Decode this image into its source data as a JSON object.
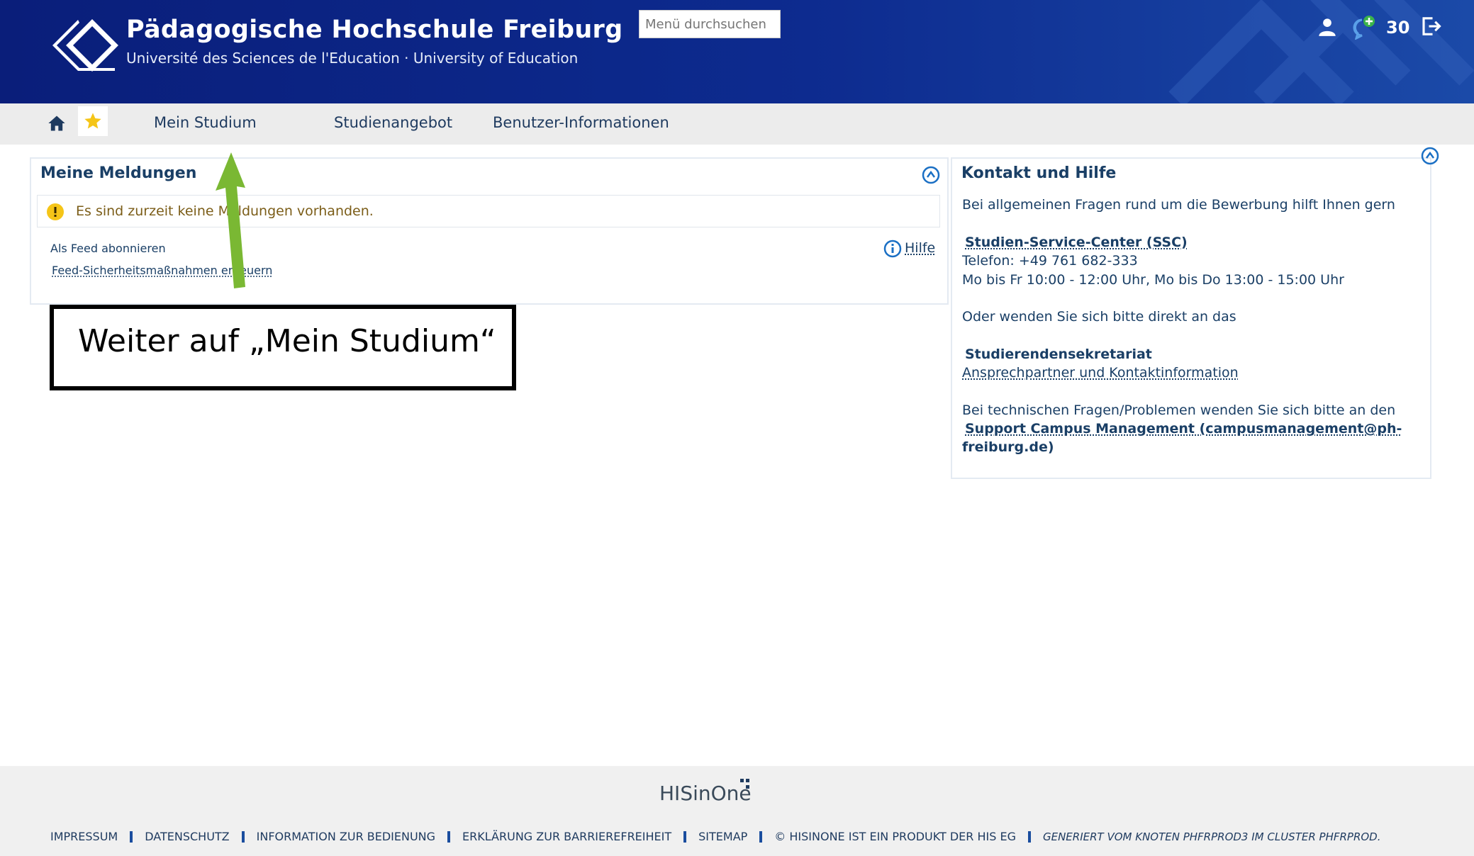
{
  "header": {
    "title": "Pädagogische Hochschule Freiburg",
    "subtitle": "Université des Sciences de l'Education · University of Education",
    "search_placeholder": "Menü durchsuchen",
    "notification_count": "30"
  },
  "nav": {
    "items": [
      "Mein Studium",
      "Studienangebot",
      "Benutzer-Informationen"
    ]
  },
  "messages_panel": {
    "title": "Meine Meldungen",
    "info_text": "Es sind zurzeit keine Meldungen vorhanden.",
    "feed_subscribe": "Als Feed abonnieren",
    "feed_security": "Feed-Sicherheitsmaßnahmen erneuern",
    "help": "Hilfe"
  },
  "contact_panel": {
    "title": "Kontakt und Hilfe",
    "intro": "Bei allgemeinen Fragen rund um die Bewerbung hilft Ihnen gern",
    "ssc_link": "Studien-Service-Center (SSC)",
    "phone": "Telefon: +49 761 682-333",
    "hours": "Mo bis Fr 10:00 - 12:00 Uhr, Mo bis Do 13:00 - 15:00 Uhr",
    "or_text": "Oder wenden Sie sich bitte direkt an das",
    "secretariat": "Studierendensekretariat",
    "contact_link": "Ansprechpartner und Kontaktinformation",
    "tech_text": "Bei technischen Fragen/Problemen wenden Sie sich bitte an den",
    "support_line1": "Support Campus Management (campusmanagement@ph-",
    "support_line2": "freiburg.de)"
  },
  "annotation": {
    "text": "Weiter auf „Mein Studium“",
    "arrow_color": "#7ab833"
  },
  "footer": {
    "brand": "HISinOne",
    "links": [
      "IMPRESSUM",
      "DATENSCHUTZ",
      "INFORMATION ZUR BEDIENUNG",
      "ERKLÄRUNG ZUR BARRIEREFREIHEIT",
      "SITEMAP",
      "© HISINONE IST EIN PRODUKT DER HIS EG"
    ],
    "generated": "GENERIERT VOM KNOTEN PHFRPROD3 IM CLUSTER PHFRPROD."
  },
  "icons": [
    "logo-diamond-icon",
    "user-icon",
    "chat-add-icon",
    "logout-icon",
    "home-icon",
    "star-icon",
    "collapse-icon",
    "info-icon",
    "help-icon"
  ],
  "colors": {
    "header": "#0d2b8f",
    "accent": "#1a4d9e",
    "warning": "#f5c518"
  }
}
